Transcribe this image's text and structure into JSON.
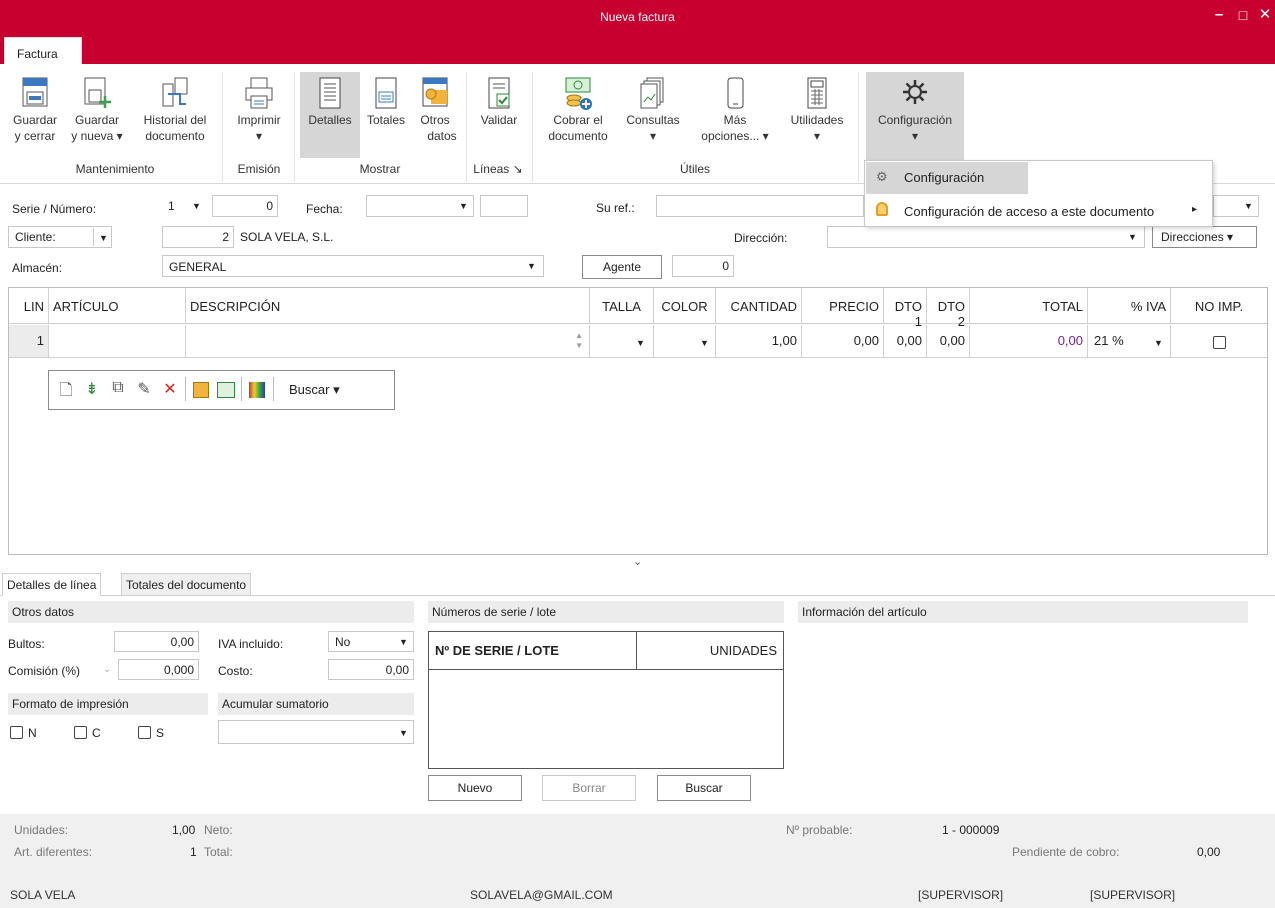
{
  "window": {
    "title": "Nueva factura",
    "min": "–",
    "max": "□",
    "close": "✕"
  },
  "ribbon": {
    "tab": "Factura",
    "buttons": {
      "guardar_cerrar": [
        "Guardar",
        "y cerrar"
      ],
      "guardar_nueva": [
        "Guardar",
        "y nueva ▾"
      ],
      "historial": [
        "Historial del",
        "documento"
      ],
      "imprimir": [
        "Imprimir",
        "▾"
      ],
      "detalles": "Detalles",
      "totales": "Totales",
      "otros_datos": [
        "Otros",
        "datos"
      ],
      "validar": "Validar",
      "cobrar": [
        "Cobrar el",
        "documento"
      ],
      "consultas": [
        "Consultas",
        "▾"
      ],
      "mas_opciones": [
        "Más",
        "opciones... ▾"
      ],
      "utilidades": [
        "Utilidades",
        "▾"
      ],
      "configuracion": [
        "Configuración",
        "▾"
      ]
    },
    "groups": {
      "mantenimiento": "Mantenimiento",
      "emision": "Emisión",
      "mostrar": "Mostrar",
      "lineas": "Líneas ↘",
      "utiles": "Útiles"
    }
  },
  "menu": {
    "items": [
      "Configuración",
      "Configuración de acceso a este documento"
    ],
    "arrow": "▸"
  },
  "header": {
    "serie_label": "Serie / Número:",
    "serie": "1",
    "numero": "0",
    "fecha_label": "Fecha:",
    "suref_label": "Su ref.:",
    "cliente_btn": "Cliente:",
    "cliente_num": "2",
    "cliente_nombre": "SOLA VELA, S.L.",
    "direccion_label": "Dirección:",
    "direcciones_btn": "Direcciones ▾",
    "almacen_label": "Almacén:",
    "almacen": "GENERAL",
    "agente_btn": "Agente",
    "agente_val": "0"
  },
  "grid": {
    "columns": [
      "LIN",
      "ARTÍCULO",
      "DESCRIPCIÓN",
      "TALLA",
      "COLOR",
      "CANTIDAD",
      "PRECIO",
      "DTO 1",
      "DTO 2",
      "TOTAL",
      "% IVA",
      "NO IMP."
    ],
    "row": {
      "lin": "1",
      "cantidad": "1,00",
      "precio": "0,00",
      "dto1": "0,00",
      "dto2": "0,00",
      "total": "0,00",
      "iva": "21 %"
    },
    "toolbar_search": "Buscar ▾",
    "colors": {
      "total": "#7a1fa2"
    }
  },
  "detail": {
    "tabs": [
      "Detalles de línea",
      "Totales del documento"
    ],
    "otros_datos": "Otros datos",
    "bultos_label": "Bultos:",
    "bultos": "0,00",
    "iva_incl_label": "IVA incluido:",
    "iva_incl": "No",
    "comision_label": "Comisión (%)",
    "comision": "0,000",
    "costo_label": "Costo:",
    "costo": "0,00",
    "formato": "Formato de impresión",
    "acumular": "Acumular sumatorio",
    "chk": [
      "N",
      "C",
      "S"
    ],
    "series_head": "Números de serie / lote",
    "series_cols": [
      "Nº DE SERIE / LOTE",
      "UNIDADES"
    ],
    "btns": [
      "Nuevo",
      "Borrar",
      "Buscar"
    ],
    "info_head": "Información del artículo"
  },
  "status": {
    "unidades_label": "Unidades:",
    "unidades": "1,00",
    "neto_label": "Neto:",
    "art_label": "Art. diferentes:",
    "art": "1",
    "total_label": "Total:",
    "probable_label": "Nº probable:",
    "probable": "1 - 000009",
    "pendiente_label": "Pendiente de cobro:",
    "pendiente": "0,00",
    "company": "SOLA VELA",
    "email": "SOLAVELA@GMAIL.COM",
    "user1": "[SUPERVISOR]",
    "user2": "[SUPERVISOR]"
  }
}
